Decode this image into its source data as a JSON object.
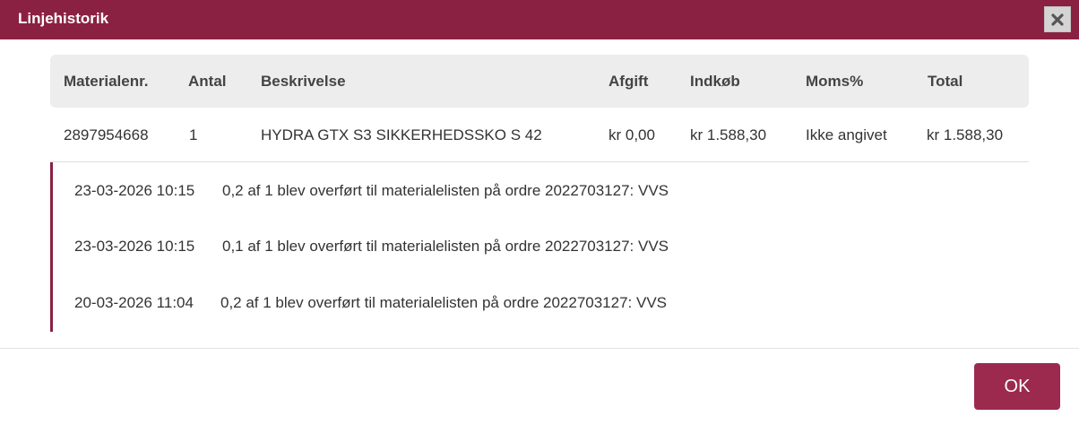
{
  "dialog": {
    "title": "Linjehistorik",
    "close_icon": "close-x-icon",
    "ok_label": "OK",
    "accent_color": "#8b2142"
  },
  "table": {
    "headers": [
      "Materialenr.",
      "Antal",
      "Beskrivelse",
      "Afgift",
      "Indkøb",
      "Moms%",
      "Total"
    ],
    "row": [
      "2897954668",
      "1",
      "HYDRA GTX S3 SIKKERHEDSSKO S 42",
      "kr 0,00",
      "kr 1.588,30",
      "Ikke angivet",
      "kr 1.588,30"
    ]
  },
  "history": [
    {
      "date": "23-03-2026 10:15",
      "text": "0,2 af 1 blev overført til materialelisten på ordre 2022703127: VVS"
    },
    {
      "date": "23-03-2026 10:15",
      "text": "0,1 af 1 blev overført til materialelisten på ordre 2022703127: VVS"
    },
    {
      "date": "20-03-2026 11:04",
      "text": "0,2 af 1 blev overført til materialelisten på ordre 2022703127: VVS"
    }
  ]
}
